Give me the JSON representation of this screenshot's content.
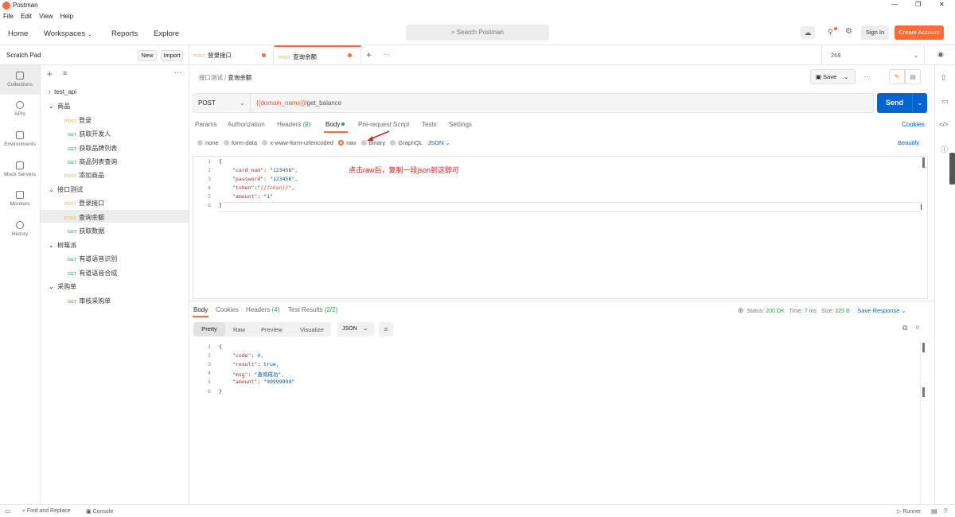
{
  "window": {
    "title": "Postman",
    "controls": [
      "—",
      "❐",
      "✕"
    ]
  },
  "menu": [
    "File",
    "Edit",
    "View",
    "Help"
  ],
  "nav": {
    "home": "Home",
    "workspaces": "Workspaces",
    "reports": "Reports",
    "explore": "Explore",
    "search_placeholder": "Search Postman",
    "signin": "Sign In",
    "create_account": "Create Account"
  },
  "scratch": {
    "title": "Scratch Pad",
    "new": "New",
    "import": "Import"
  },
  "rail": [
    "Collections",
    "APIs",
    "Environments",
    "Mock Servers",
    "Monitors",
    "History"
  ],
  "tree": [
    {
      "type": "folder",
      "label": "test_api",
      "expanded": false
    },
    {
      "type": "folder",
      "label": "商品",
      "expanded": true
    },
    {
      "type": "req",
      "method": "POST",
      "label": "登录"
    },
    {
      "type": "req",
      "method": "GET",
      "label": "获取开发人"
    },
    {
      "type": "req",
      "method": "GET",
      "label": "获取品牌列表"
    },
    {
      "type": "req",
      "method": "GET",
      "label": "商品列表查询"
    },
    {
      "type": "req",
      "method": "POST",
      "label": "添加商品"
    },
    {
      "type": "folder",
      "label": "接口测试",
      "expanded": true
    },
    {
      "type": "req",
      "method": "POST",
      "label": "登录接口"
    },
    {
      "type": "req",
      "method": "POST",
      "label": "查询余额",
      "selected": true
    },
    {
      "type": "req",
      "method": "GET",
      "label": "获取数据"
    },
    {
      "type": "folder",
      "label": "树莓派",
      "expanded": true
    },
    {
      "type": "req",
      "method": "GET",
      "label": "有道语音识别"
    },
    {
      "type": "req",
      "method": "GET",
      "label": "有道语音合成"
    },
    {
      "type": "folder",
      "label": "采购单",
      "expanded": true
    },
    {
      "type": "req",
      "method": "GET",
      "label": "审核采购单"
    }
  ],
  "tabs": [
    {
      "method": "POST",
      "label": "登录接口"
    },
    {
      "method": "POST",
      "label": "查询余额"
    }
  ],
  "env": {
    "value": "268"
  },
  "breadcrumb": {
    "parent": "接口测试",
    "sep": "/",
    "current": "查询余额"
  },
  "save": "Save",
  "request": {
    "method": "POST",
    "url_var": "{{domain_name}}",
    "url_path": "/get_balance",
    "send": "Send"
  },
  "req_tabs": {
    "params": "Params",
    "auth": "Authorization",
    "headers": "Headers",
    "headers_count": "(9)",
    "body": "Body",
    "prereq": "Pre-request Script",
    "tests": "Tests",
    "settings": "Settings",
    "cookies": "Cookies"
  },
  "body_types": {
    "none": "none",
    "form": "form-data",
    "urlenc": "x-www-form-urlencoded",
    "raw": "raw",
    "binary": "binary",
    "graphql": "GraphQL",
    "json": "JSON",
    "beautify": "Beautify"
  },
  "annotation": "点击raw后，复制一段json到这即可",
  "req_body": {
    "l1": "{",
    "card_key": "\"card_num\"",
    "card_val": "\"123456\",",
    "pwd_key": "\"password\"",
    "pwd_val": "\"123456\",",
    "tok_key": "\"token\"",
    "tok_q1": "\"",
    "tok_var": "{{token}}",
    "tok_q2": "\",",
    "amt_key": "\"amount\"",
    "amt_val": "\"1\"",
    "l6": "}",
    "colon": ":"
  },
  "resp_tabs": {
    "body": "Body",
    "cookies": "Cookies",
    "headers": "Headers",
    "headers_count": "(4)",
    "tests": "Test Results",
    "tests_count": "(2/2)"
  },
  "resp_status": {
    "status_label": "Status:",
    "status": "200 OK",
    "time_label": "Time:",
    "time": "7 ms",
    "size_label": "Size:",
    "size": "225 B",
    "save": "Save Response"
  },
  "resp_view": {
    "pretty": "Pretty",
    "raw": "Raw",
    "preview": "Preview",
    "visualize": "Visualize",
    "json": "JSON"
  },
  "resp_body": {
    "l1": "{",
    "code_key": "\"code\"",
    "code_val": "0,",
    "res_key": "\"result\"",
    "res_val": "true,",
    "msg_key": "\"msg\"",
    "msg_val": "\"查询成功\",",
    "amt_key": "\"amount\"",
    "amt_val": "\"99999999\"",
    "l6": "}",
    "colon": ":"
  },
  "statusbar": {
    "find": "Find and Replace",
    "console": "Console",
    "runner": "Runner"
  },
  "colors": {
    "accent": "#ff6c37",
    "send": "#0265d2",
    "link": "#0265d2"
  }
}
